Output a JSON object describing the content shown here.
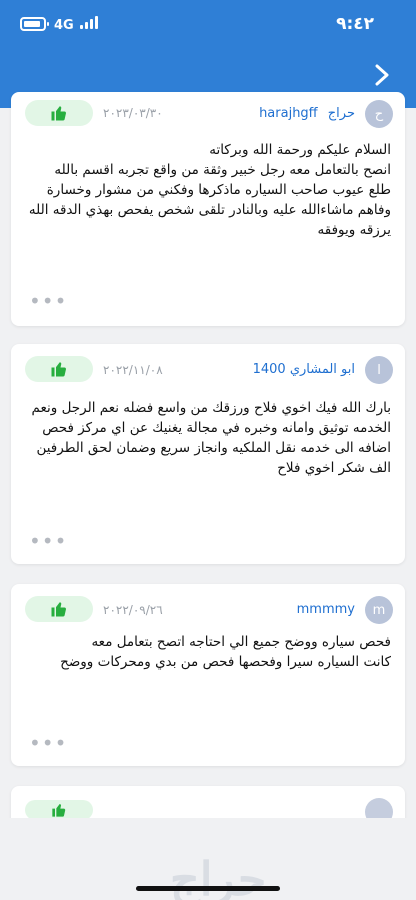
{
  "status_bar": {
    "time": "٩:٤٢",
    "network": "4G"
  },
  "colors": {
    "header": "#2f7fd6",
    "username": "#1f6fd0",
    "like_bg": "#e2f6e6",
    "like_icon": "#27ae3f"
  },
  "header": {
    "back_icon": "chevron-right-icon"
  },
  "reviews": [
    {
      "avatar": "ح",
      "user": "harajhgff",
      "user_sub": "حراج",
      "date": "٢٠٢٣/٠٣/٣٠",
      "lines": [
        "السلام عليكم ورحمة الله وبركاته",
        "انصح بالتعامل معه رجل خبير وثقة من واقع تجربه اقسم بالله",
        "طلع عيوب صاحب السياره ماذكرها وفكني من مشوار وخسارة",
        "وفاهم ماشاءالله عليه وبالنادر تلقى شخص يفحص بهذي الدقه الله",
        "يرزقه ويوفقه"
      ],
      "more": "•••"
    },
    {
      "avatar": "ا",
      "user": "ابو المشاري 1400",
      "user_sub": "",
      "date": "٢٠٢٢/١١/٠٨",
      "lines": [
        "بارك الله فيك اخوي فلاح ورزقك من واسع فضله نعم الرجل ونعم",
        "الخدمه توثيق وامانه وخبره في مجالة يغنيك عن اي مركز فحص",
        "اضافه الى خدمه نقل الملكيه وانجاز سريع وضمان لحق الطرفين",
        "الف شكر اخوي فلاح"
      ],
      "more": "•••"
    },
    {
      "avatar": "m",
      "user": "mmmmy",
      "user_sub": "",
      "date": "٢٠٢٢/٠٩/٢٦",
      "lines": [
        "فحص سياره ووضح جميع الي احتاجه اتصح بتعامل معه",
        "كانت السياره سيرا وفحصها فحص من بدي ومحركات ووضح"
      ],
      "more": "•••"
    }
  ],
  "footer": {
    "logo": "حراج"
  }
}
